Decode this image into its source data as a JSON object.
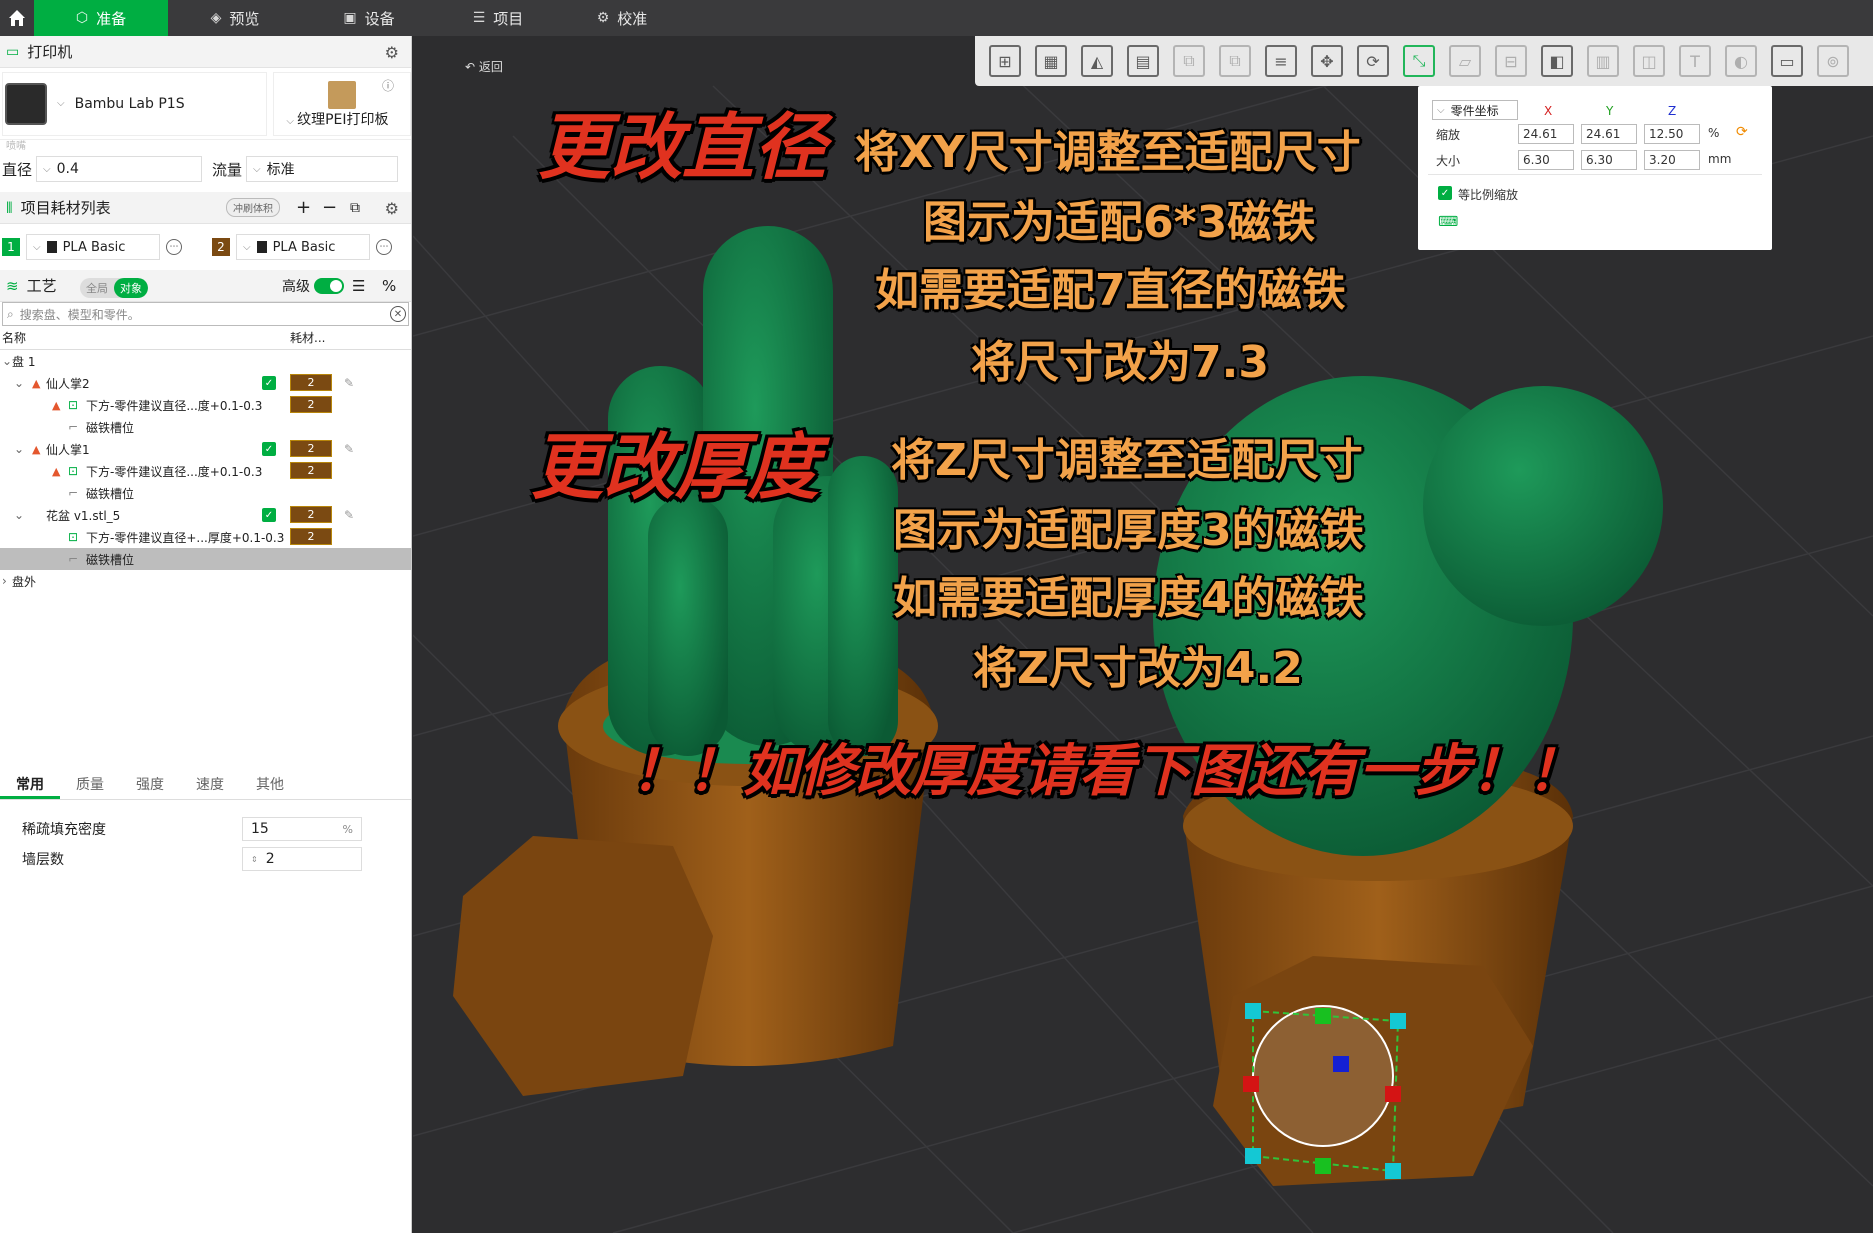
{
  "topbar": {
    "tabs": [
      {
        "label": "准备",
        "icon": "cube-icon",
        "active": true
      },
      {
        "label": "预览",
        "icon": "layers-icon"
      },
      {
        "label": "设备",
        "icon": "device-icon"
      },
      {
        "label": "项目",
        "icon": "project-icon"
      },
      {
        "label": "校准",
        "icon": "calibrate-icon"
      }
    ],
    "accent": "#00ae42"
  },
  "printer": {
    "section_title": "打印机",
    "name": "Bambu Lab P1S",
    "plate": "纹理PEI打印板",
    "nozzle_caption": "喷嘴",
    "diameter_label": "直径",
    "diameter_value": "0.4",
    "flow_label": "流量",
    "flow_value": "标准"
  },
  "filaments": {
    "section_title": "项目耗材列表",
    "purge_label": "冲刷体积",
    "items": [
      {
        "index": "1",
        "name": "PLA Basic",
        "color": "#00ae42"
      },
      {
        "index": "2",
        "name": "PLA Basic",
        "color": "#7b4a12"
      }
    ]
  },
  "process": {
    "section_title": "工艺",
    "seg_global": "全局",
    "seg_object": "对象",
    "advanced_label": "高级",
    "search_placeholder": "搜索盘、模型和零件。",
    "col_name": "名称",
    "col_filament": "耗材..."
  },
  "tree": [
    {
      "label": "盘 1",
      "indent": 0,
      "arrow": "⌄"
    },
    {
      "label": "仙人掌2",
      "indent": 1,
      "arrow": "⌄",
      "warn": true,
      "check": true,
      "num": "2"
    },
    {
      "label": "下方-零件建议直径...度+0.1-0.3",
      "indent": 2,
      "warn": true,
      "part": true,
      "num": "2"
    },
    {
      "label": "磁铁槽位",
      "indent": 2,
      "neg": true
    },
    {
      "label": "仙人掌1",
      "indent": 1,
      "arrow": "⌄",
      "warn": true,
      "check": true,
      "num": "2"
    },
    {
      "label": "下方-零件建议直径...度+0.1-0.3",
      "indent": 2,
      "warn": true,
      "part": true,
      "num": "2"
    },
    {
      "label": "磁铁槽位",
      "indent": 2,
      "neg": true
    },
    {
      "label": "花盆 v1.stl_5",
      "indent": 1,
      "arrow": "⌄",
      "check": true,
      "num": "2"
    },
    {
      "label": "下方-零件建议直径+...厚度+0.1-0.3",
      "indent": 2,
      "part": true,
      "num": "2"
    },
    {
      "label": "磁铁槽位",
      "indent": 2,
      "neg": true,
      "selected": true
    },
    {
      "label": "盘外",
      "indent": 0,
      "arrow": "›"
    }
  ],
  "params": {
    "tabs": [
      "常用",
      "质量",
      "强度",
      "速度",
      "其他"
    ],
    "rows": [
      {
        "label": "稀疏填充密度",
        "value": "15",
        "unit": "%"
      },
      {
        "label": "墙层数",
        "value": "2",
        "unit": ""
      }
    ]
  },
  "viewport": {
    "back_label": "返回",
    "panel": {
      "coord_label": "零件坐标",
      "x": "X",
      "y": "Y",
      "z": "Z",
      "scale_label": "缩放",
      "scale": [
        "24.61",
        "24.61",
        "12.50"
      ],
      "scale_unit": "%",
      "size_label": "大小",
      "size": [
        "6.30",
        "6.30",
        "3.20"
      ],
      "size_unit": "mm",
      "uniform_label": "等比例缩放"
    },
    "annotations": {
      "title1": "更改直径",
      "lines1": [
        "将XY尺寸调整至适配尺寸",
        "图示为适配6*3磁铁",
        "如需要适配7直径的磁铁",
        "将尺寸改为7.3"
      ],
      "title2": "更改厚度",
      "lines2": [
        "将Z尺寸调整至适配尺寸",
        "图示为适配厚度3的磁铁",
        "如需要适配厚度4的磁铁",
        "将Z尺寸改为4.2"
      ],
      "warning": "！！如修改厚度请看下图还有一步！！"
    }
  }
}
